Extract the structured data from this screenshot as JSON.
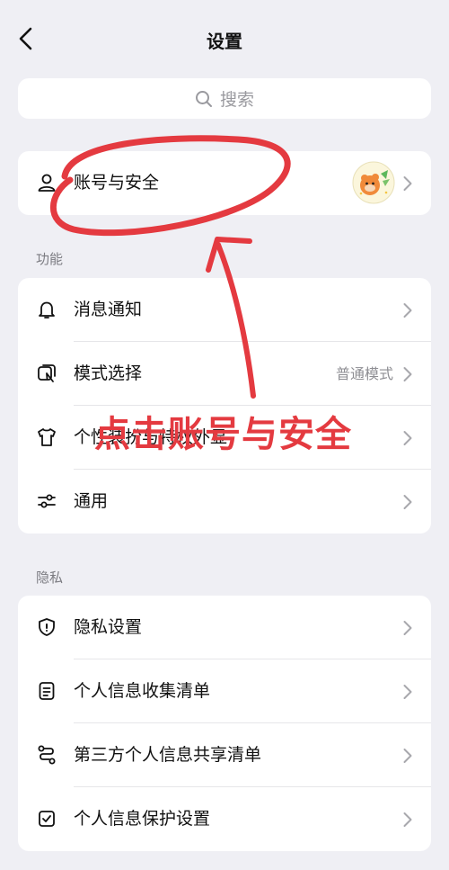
{
  "header": {
    "title": "设置"
  },
  "search": {
    "placeholder": "搜索"
  },
  "account": {
    "label": "账号与安全"
  },
  "sections": {
    "features": "功能",
    "privacy": "隐私"
  },
  "features": [
    {
      "label": "消息通知",
      "icon": "bell-icon"
    },
    {
      "label": "模式选择",
      "icon": "mode-icon",
      "value": "普通模式"
    },
    {
      "label": "个性装扮与特权外显",
      "icon": "tshirt-icon"
    },
    {
      "label": "通用",
      "icon": "sliders-icon"
    }
  ],
  "privacy": [
    {
      "label": "隐私设置",
      "icon": "shield-icon"
    },
    {
      "label": "个人信息收集清单",
      "icon": "document-icon"
    },
    {
      "label": "第三方个人信息共享清单",
      "icon": "share-icon"
    },
    {
      "label": "个人信息保护设置",
      "icon": "checkbox-icon"
    }
  ],
  "annotation": {
    "text": "点击账号与安全",
    "color": "#e43a40"
  }
}
